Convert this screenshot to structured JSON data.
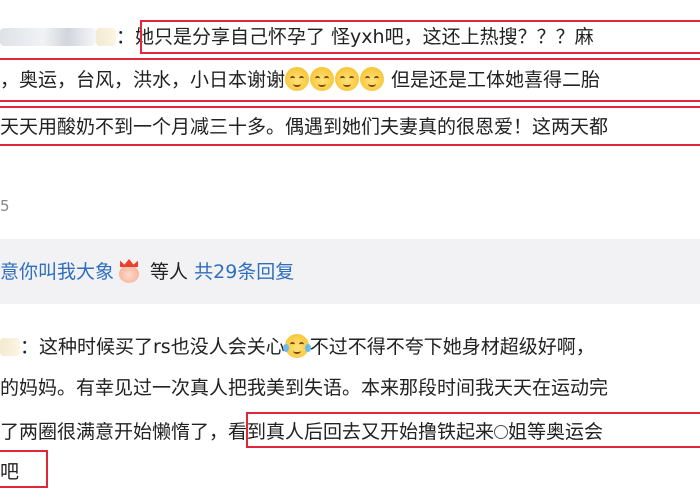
{
  "comment1": {
    "line1_text": "：她只是分享自己怀孕了 怪yxh吧，这还上热搜？？？麻",
    "line2_text_a": "，奥运，台风，洪水，小日本谢谢",
    "line2_text_b": " 但是还是工体她喜得二胎",
    "line3_text": "天天用酸奶不到一个月减三十多。偶遇到她们夫妻真的很恩爱！这两天都"
  },
  "likes": {
    "count": "5"
  },
  "replies": {
    "name": "意你叫我大象",
    "suffix": " 等人 ",
    "count_text": "共29条回复"
  },
  "comment2": {
    "line1_text_a": "：这种时候买了rs也没人会关心",
    "line1_text_b": "不过不得不夸下她身材超级好啊，",
    "line2_text": "的妈妈。有幸见过一次真人把我美到失语。本来那段时间我天天在运动完",
    "line3_text_a": "了两圈很满意开始懒惰了",
    "line3_text_b": "，看到真人后回去又开始撸铁起来",
    "line3_text_c": "姐等奥运会",
    "line4_text": "吧"
  },
  "colors": {
    "highlight_box": "#e0263a",
    "link_blue": "#2f6fbf",
    "reply_bg": "#f2f2f5"
  },
  "icons": [
    "smiling-cat-emoji",
    "crying-laughing-emoji",
    "smile-emoji",
    "crown-avatar"
  ]
}
